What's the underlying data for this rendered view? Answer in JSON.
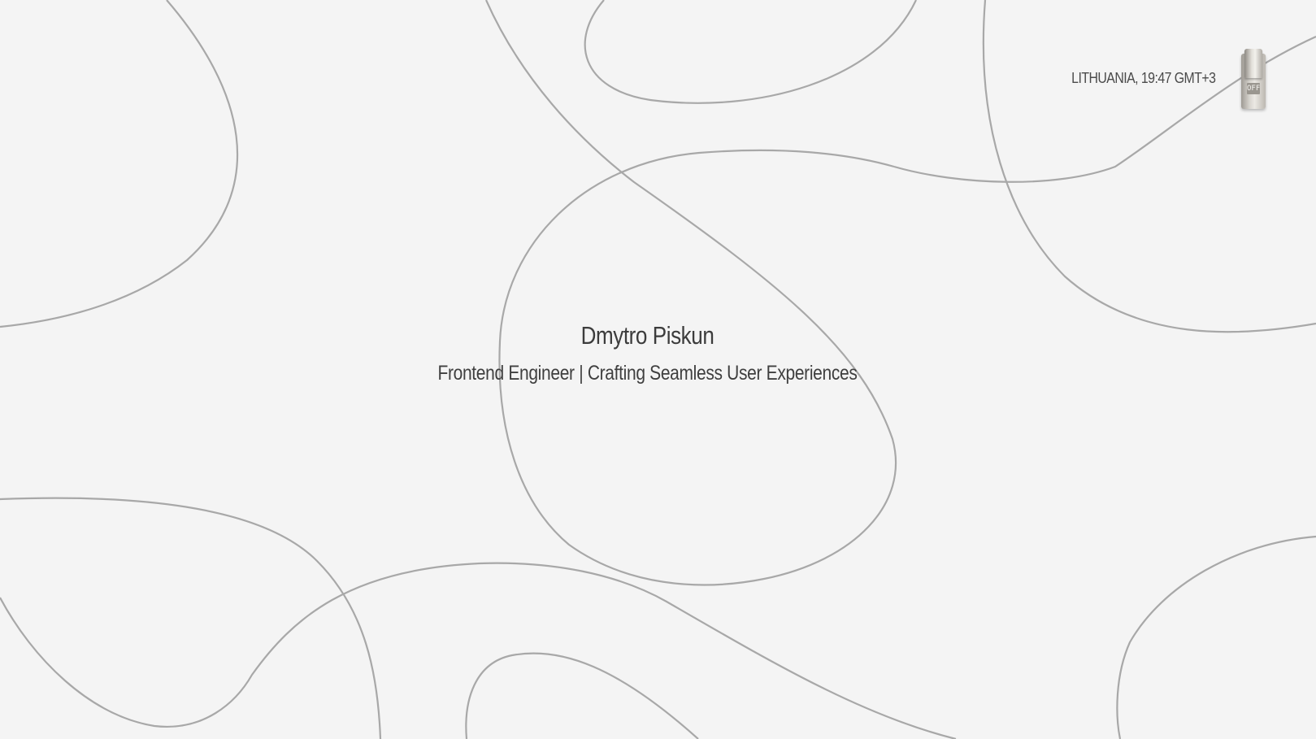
{
  "header": {
    "location_time": "LITHUANIA, 19:47 GMT+3",
    "theme_switch_label": "OFF"
  },
  "hero": {
    "name": "Dmytro Piskun",
    "tagline": "Frontend Engineer | Crafting Seamless User Experiences"
  },
  "colors": {
    "background": "#f4f4f4",
    "line": "#a8a8a8",
    "text": "#3c3c3c"
  }
}
